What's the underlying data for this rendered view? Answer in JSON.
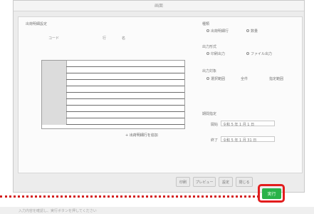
{
  "window": {
    "title": "画面"
  },
  "left": {
    "section_label": "出荷明細設定",
    "columns": [
      "コード",
      "行",
      "名"
    ],
    "row_count": 10,
    "link_text": "+ 出荷明細行を追加"
  },
  "right": {
    "group1": {
      "label": "種類",
      "options": [
        "出荷明細行",
        "数量"
      ]
    },
    "group2": {
      "label": "出力形式",
      "options": [
        "印刷出力",
        "ファイル出力"
      ]
    },
    "group3": {
      "label": "出力対象",
      "options": [
        "選択範囲",
        "全件",
        "指定範囲"
      ]
    },
    "period": {
      "label": "期間指定",
      "from_label": "開始",
      "to_label": "終了",
      "from_value": "令和 5 年 1 月 1 日",
      "to_value": "令和 5 年 1 月 31 日"
    }
  },
  "buttons": {
    "b1": "印刷",
    "b2": "プレビュー",
    "b3": "設定",
    "b4": "閉じる",
    "ok": "実行"
  },
  "status": {
    "text": "入力内容を確認し、実行ボタンを押してください"
  },
  "colors": {
    "ok": "#29b24a",
    "highlight": "#e21d1d"
  }
}
